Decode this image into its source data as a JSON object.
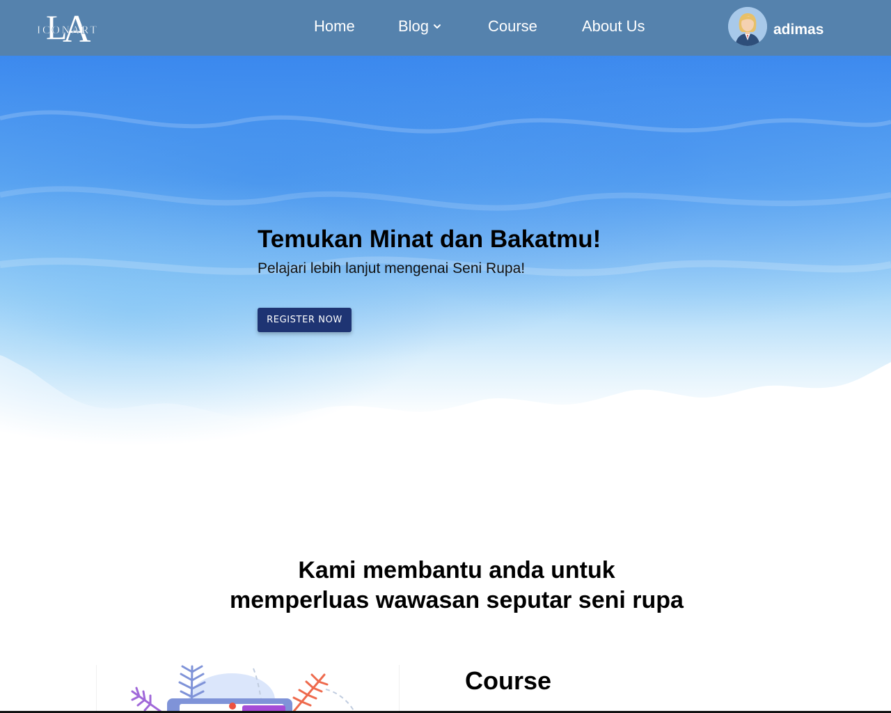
{
  "colors": {
    "navbar": "#5582ad",
    "button": "#1e3473",
    "hero_blue": "#3f8ff0"
  },
  "navbar": {
    "logo_text": "LA ICONART",
    "items": [
      {
        "label": "Home"
      },
      {
        "label": "Blog",
        "icon": "chevron-down-icon"
      },
      {
        "label": "Course"
      },
      {
        "label": "About Us"
      }
    ],
    "user": {
      "name": "adimas",
      "avatar_icon": "user-avatar-icon"
    }
  },
  "hero": {
    "title": "Temukan Minat dan Bakatmu!",
    "subtitle": "Pelajari lebih lanjut mengenai Seni Rupa!",
    "button_label": "REGISTER NOW"
  },
  "section": {
    "title_line1": "Kami membantu anda untuk",
    "title_line2": "memperluas wawasan seputar seni rupa"
  },
  "feature": {
    "heading": "Course",
    "illustration_icon": "course-illustration-icon"
  }
}
